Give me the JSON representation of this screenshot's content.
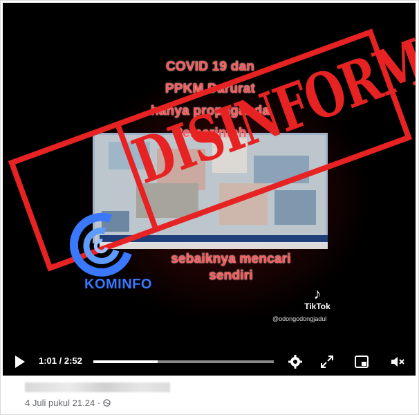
{
  "video": {
    "caption_lines": [
      "COVID 19 dan",
      "PPKM Darurat",
      "hanya propaganda",
      "Pemerintah"
    ],
    "caption_bottom_lines": [
      "sebaiknya mencari",
      "sendiri"
    ],
    "stamp_text": "DISINFORMASI",
    "logo_text": "KOMINFO",
    "tiktok_label": "TikTok",
    "tiktok_handle": "@odongodongjadul",
    "time_display": "1:01 / 2:52",
    "progress_fraction": 0.355
  },
  "post": {
    "timestamp": "4 Juli pukul 21.24 ·"
  },
  "colors": {
    "stamp_red": "#e62222",
    "caption_red": "#ff5555",
    "logo_blue": "#3a78ff"
  },
  "icons": [
    "play-icon",
    "settings-icon",
    "fullscreen-icon",
    "miniplayer-icon",
    "volume-muted-icon",
    "globe-icon",
    "tiktok-icon"
  ]
}
